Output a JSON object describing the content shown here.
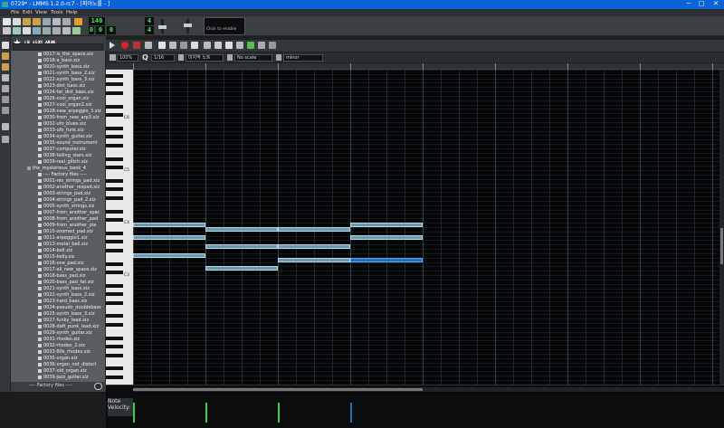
{
  "window": {
    "title": "0729* - LMMS 1.2.0-rc7 - [피아노롤 - ]",
    "controls": [
      "─",
      "□",
      "✕"
    ]
  },
  "menu": [
    "File",
    "Edit",
    "View",
    "Tools",
    "Help"
  ],
  "toolbar": {
    "tempo": "140",
    "timesig_top": "4",
    "timesig_bottom": "4",
    "time_min": "0",
    "time_sec": "0",
    "time_ms": "0",
    "cpu_text": "Click to enable"
  },
  "browser": {
    "title": "내 사진 샘플",
    "folder_instrument": "the_mysterious_bank_4",
    "items_top": [
      "0017-is_the_space.xiz",
      "0018-a_bass.xiz",
      "0020-synth_bass.xiz",
      "0021-synth_bass_2.xiz",
      "0022-synth_bass_3.xiz",
      "0023-dist_bass.xiz",
      "0024-fat_dist_bass.xiz",
      "0026-cool_organ.xiz",
      "0027-cool_organ2.xiz",
      "0028-new_arpeggio_3.xiz",
      "0030-from_new_arp3.xiz",
      "0032-ufo_blues.xiz",
      "0033-ufo_funk.xiz",
      "0034-synth_guitar.xiz",
      "0035-sound_instrument",
      "0037-computer.xiz",
      "0038-falling_stars.xiz",
      "0039-real_glitch.xiz"
    ],
    "factory_header": "---- Factory files ----",
    "items_bottom": [
      "0001-res_strings_pad.xiz",
      "0002-another_respad.xiz",
      "0003-strings_pad.xiz",
      "0004-strings_pad_2.xiz",
      "0005-synth_strings.xiz",
      "0007-from_another_spac",
      "0008-from_another_pad",
      "0009-from_another_pia",
      "0010-zoomed_pad.xiz",
      "0011-arpeggio1.xiz",
      "0013-metal_bell.xiz",
      "0014-bell.xiz",
      "0015-belly.xiz",
      "0016-one_pad.xiz",
      "0017-all_new_space.xiz",
      "0018-bass_pad.xiz",
      "0020-bass_pad_fat.xiz",
      "0021-synth_bass.xiz",
      "0022-synth_bass_2.xiz",
      "0023-hard_bass.xiz",
      "0024-pseudo_doublebass",
      "0025-synth_bass_3.xiz",
      "0027-funky_lead.xiz",
      "0028-daft_punk_lead.xiz",
      "0029-synth_guitar.xiz",
      "0031-rhodes.xiz",
      "0032-rhodes_2.xiz",
      "0033-80s_rhodes.xiz",
      "0035-organ.xiz",
      "0036-organ_not_distort",
      "0037-old_organ.xiz",
      "0039-jazz_guitar.xiz"
    ],
    "footer": "---- Factory files ----"
  },
  "pianoroll": {
    "zoom": "100%",
    "quant": "1/16",
    "note_len": "마지막 노트",
    "scale": "No scale",
    "chord": "minor",
    "octave_labels": [
      "C6",
      "C5",
      "C4",
      "C3"
    ],
    "velocity_label": "Note Velocity:"
  },
  "colors": {
    "note": "#6a9ab0",
    "note_selected": "#1f6fbf",
    "velocity": "#3fd13c"
  },
  "notes": [
    {
      "bar": 0,
      "start16": 0,
      "len16": 16,
      "key": 0,
      "selected": false
    },
    {
      "bar": 1,
      "start16": 0,
      "len16": 16,
      "key": 1,
      "selected": false
    },
    {
      "bar": 2,
      "start16": 0,
      "len16": 16,
      "key": 1,
      "selected": false
    },
    {
      "bar": 3,
      "start16": 0,
      "len16": 16,
      "key": 0,
      "selected": false
    },
    {
      "bar": 0,
      "start16": 0,
      "len16": 16,
      "key": 3,
      "selected": false
    },
    {
      "bar": 1,
      "start16": 0,
      "len16": 16,
      "key": 5,
      "selected": false
    },
    {
      "bar": 2,
      "start16": 0,
      "len16": 16,
      "key": 5,
      "selected": false
    },
    {
      "bar": 3,
      "start16": 0,
      "len16": 16,
      "key": 3,
      "selected": false
    },
    {
      "bar": 0,
      "start16": 0,
      "len16": 16,
      "key": 7,
      "selected": false
    },
    {
      "bar": 2,
      "start16": 0,
      "len16": 16,
      "key": 8,
      "selected": false
    },
    {
      "bar": 1,
      "start16": 0,
      "len16": 16,
      "key": 10,
      "selected": false
    },
    {
      "bar": 3,
      "start16": 0,
      "len16": 16,
      "key": 8,
      "selected": true
    }
  ]
}
